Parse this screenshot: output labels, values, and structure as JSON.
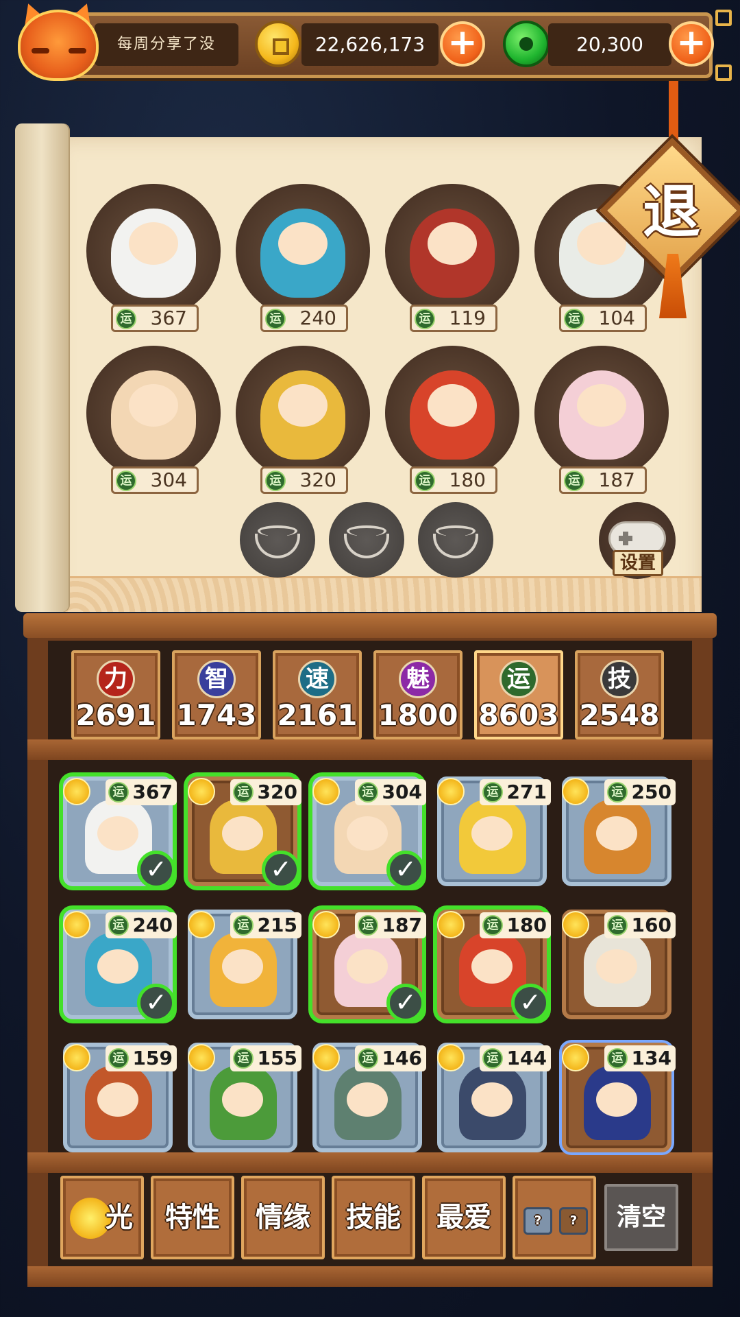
{
  "header": {
    "tagline": "每周分享了没",
    "coins": "22,626,173",
    "jade": "20,300",
    "plus_symbol": "+"
  },
  "exit": {
    "label": "退"
  },
  "settings": {
    "label": "设置"
  },
  "luck_symbol": "运",
  "team": [
    {
      "luck": "367",
      "color": "#f2f2f0"
    },
    {
      "luck": "240",
      "color": "#3aa7c8"
    },
    {
      "luck": "119",
      "color": "#b1362a"
    },
    {
      "luck": "104",
      "color": "#e9ece7"
    },
    {
      "luck": "304",
      "color": "#f3d7b4"
    },
    {
      "luck": "320",
      "color": "#e9b93c"
    },
    {
      "luck": "180",
      "color": "#d8442a"
    },
    {
      "luck": "187",
      "color": "#f4cfd6"
    }
  ],
  "stats": [
    {
      "symbol": "力",
      "value": "2691",
      "icon_color": "#b5251b",
      "active": false
    },
    {
      "symbol": "智",
      "value": "1743",
      "icon_color": "#3a3f9c",
      "active": false
    },
    {
      "symbol": "速",
      "value": "2161",
      "icon_color": "#1d6d86",
      "active": false
    },
    {
      "symbol": "魅",
      "value": "1800",
      "icon_color": "#8c2aa6",
      "active": false
    },
    {
      "symbol": "运",
      "value": "8603",
      "icon_color": "#2f6a2d",
      "active": true
    },
    {
      "symbol": "技",
      "value": "2548",
      "icon_color": "#3a3a3a",
      "active": false
    }
  ],
  "roster": [
    {
      "luck": "367",
      "selected": true,
      "frame": "silver",
      "color": "#f2f2f0"
    },
    {
      "luck": "320",
      "selected": true,
      "frame": "brown",
      "color": "#e9b93c"
    },
    {
      "luck": "304",
      "selected": true,
      "frame": "silver",
      "color": "#f3d7b4"
    },
    {
      "luck": "271",
      "selected": false,
      "frame": "silver",
      "color": "#f2c93a"
    },
    {
      "luck": "250",
      "selected": false,
      "frame": "silver",
      "color": "#d7862e"
    },
    {
      "luck": "240",
      "selected": true,
      "frame": "silver",
      "color": "#3aa7c8"
    },
    {
      "luck": "215",
      "selected": false,
      "frame": "silver",
      "color": "#f1b33a"
    },
    {
      "luck": "187",
      "selected": true,
      "frame": "brown",
      "color": "#f4cfd6"
    },
    {
      "luck": "180",
      "selected": true,
      "frame": "brown",
      "color": "#d8442a"
    },
    {
      "luck": "160",
      "selected": false,
      "frame": "brown",
      "color": "#e8e4d8"
    },
    {
      "luck": "159",
      "selected": false,
      "frame": "silver",
      "color": "#c2572a"
    },
    {
      "luck": "155",
      "selected": false,
      "frame": "silver",
      "color": "#4c9b3a"
    },
    {
      "luck": "146",
      "selected": false,
      "frame": "silver",
      "color": "#5e8070"
    },
    {
      "luck": "144",
      "selected": false,
      "frame": "silver",
      "color": "#3b4a6a"
    },
    {
      "luck": "134",
      "selected": false,
      "frame": "brown-glow",
      "color": "#2a3a8a"
    }
  ],
  "filters": {
    "light": "光",
    "traits": "特性",
    "bond": "情缘",
    "skills": "技能",
    "favorite": "最爱",
    "unknown": "?",
    "clear": "清空"
  },
  "check_symbol": "✓"
}
